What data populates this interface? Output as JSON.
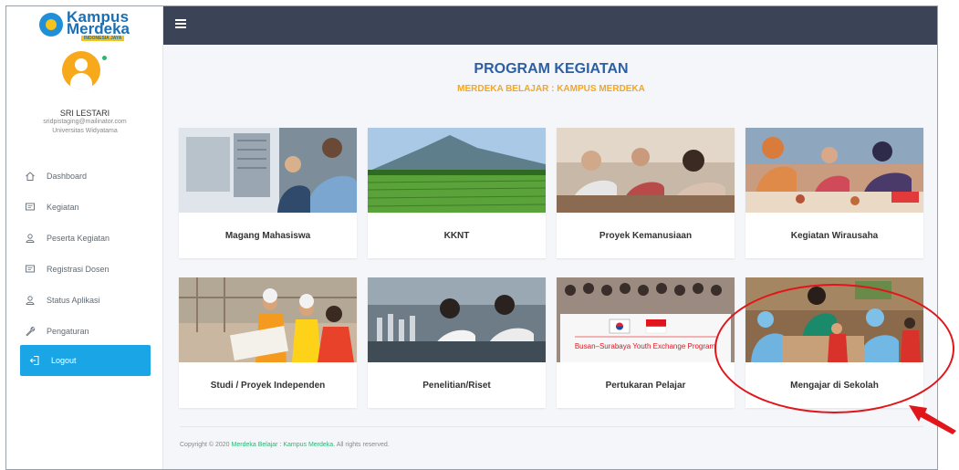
{
  "app": {
    "logo": {
      "line1": "Kampus",
      "line2": "Merdeka",
      "tag": "INDONESIA JAYA"
    }
  },
  "user": {
    "name": "SRI LESTARI",
    "email": "sridpistaging@mailinator.com",
    "university": "Universitas Widyatama"
  },
  "sidebar": {
    "items": [
      {
        "label": "Dashboard",
        "icon": "home-icon"
      },
      {
        "label": "Kegiatan",
        "icon": "chat-icon"
      },
      {
        "label": "Peserta Kegiatan",
        "icon": "user-icon"
      },
      {
        "label": "Registrasi Dosen",
        "icon": "chat-icon"
      },
      {
        "label": "Status Aplikasi",
        "icon": "user-icon"
      },
      {
        "label": "Pengaturan",
        "icon": "wrench-icon"
      }
    ],
    "logout_label": "Logout"
  },
  "main": {
    "title": "PROGRAM KEGIATAN",
    "subtitle": "MERDEKA BELAJAR : KAMPUS MERDEKA",
    "programs": [
      {
        "label": "Magang Mahasiswa"
      },
      {
        "label": "KKNT"
      },
      {
        "label": "Proyek Kemanusiaan"
      },
      {
        "label": "Kegiatan Wirausaha"
      },
      {
        "label": "Studi / Proyek Independen"
      },
      {
        "label": "Penelitian/Riset"
      },
      {
        "label": "Pertukaran Pelajar"
      },
      {
        "label": "Mengajar di Sekolah"
      }
    ],
    "banner_text": "Busan–Surabaya Youth Exchange Program"
  },
  "footer": {
    "prefix": "Copyright © 2020 ",
    "brand": "Merdeka Belajar : Kampus Merdeka",
    "suffix": ". All rights reserved."
  },
  "colors": {
    "topbar": "#3a4456",
    "accent": "#1aa5e6",
    "title": "#2d5fa3",
    "subtitle": "#f5a623",
    "annotation": "#e0161b"
  }
}
